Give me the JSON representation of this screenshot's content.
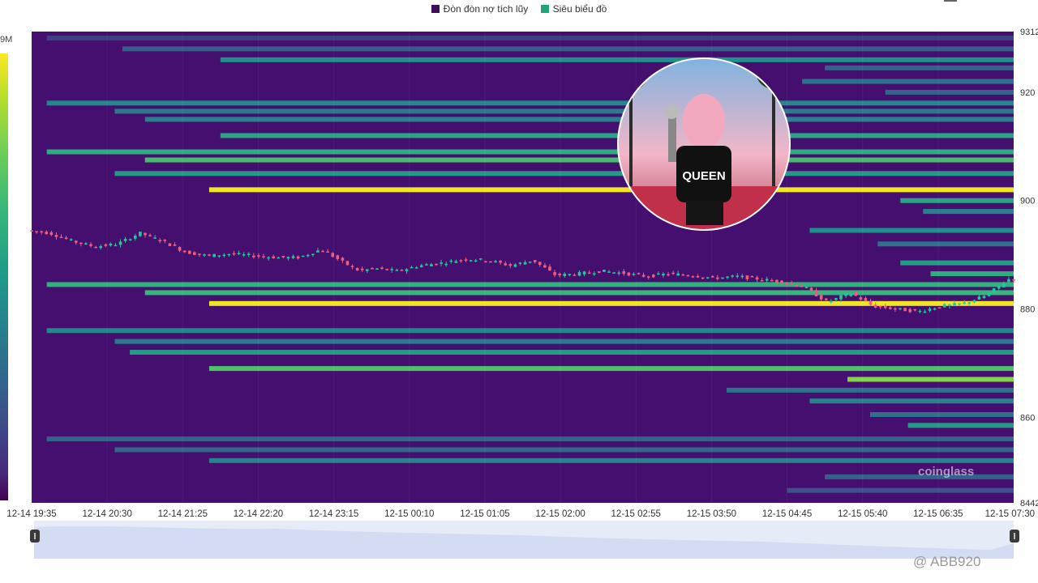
{
  "legend": {
    "items": [
      {
        "label": "Đòn đòn nợ tích lũy",
        "color": "#3b0f5c"
      },
      {
        "label": "Siêu biểu đồ",
        "color": "#1fa67a"
      }
    ]
  },
  "colorbar": {
    "label": "9M"
  },
  "watermark": "coinglass",
  "credit": "@ ABB920",
  "chart_data": {
    "type": "heatmap",
    "title": "",
    "ylim": [
      84420,
      93120
    ],
    "y_ticks": [
      "9312",
      "920",
      "900",
      "880",
      "860",
      "8442"
    ],
    "y_tick_values": [
      93120,
      92000,
      90000,
      88000,
      86000,
      84420
    ],
    "x_ticks": [
      "12-14 19:35",
      "12-14 20:30",
      "12-14 21:25",
      "12-14 22:20",
      "12-14 23:15",
      "12-15 00:10",
      "12-15 01:05",
      "12-15 02:00",
      "12-15 02:55",
      "12-15 03:50",
      "12-15 04:45",
      "12-15 05:40",
      "12-15 06:35",
      "12-15 07:30"
    ],
    "xlim": [
      0,
      13
    ],
    "background_color": "#440f6e",
    "bands": [
      {
        "price": 93000,
        "start": 0.2,
        "intensity": 0.18
      },
      {
        "price": 92800,
        "start": 1.2,
        "intensity": 0.28
      },
      {
        "price": 92600,
        "start": 2.5,
        "intensity": 0.45
      },
      {
        "price": 92450,
        "start": 10.5,
        "intensity": 0.3
      },
      {
        "price": 92200,
        "start": 10.2,
        "intensity": 0.35
      },
      {
        "price": 92000,
        "start": 11.3,
        "intensity": 0.3
      },
      {
        "price": 91800,
        "start": 0.2,
        "intensity": 0.42
      },
      {
        "price": 91650,
        "start": 1.1,
        "intensity": 0.38
      },
      {
        "price": 91500,
        "start": 1.5,
        "intensity": 0.4
      },
      {
        "price": 91200,
        "start": 2.5,
        "intensity": 0.55
      },
      {
        "price": 90900,
        "start": 0.2,
        "intensity": 0.6
      },
      {
        "price": 90750,
        "start": 1.5,
        "intensity": 0.68
      },
      {
        "price": 90500,
        "start": 1.1,
        "intensity": 0.5
      },
      {
        "price": 90200,
        "start": 2.35,
        "intensity": 0.98
      },
      {
        "price": 90000,
        "start": 11.5,
        "intensity": 0.55
      },
      {
        "price": 89800,
        "start": 11.8,
        "intensity": 0.4
      },
      {
        "price": 89450,
        "start": 10.3,
        "intensity": 0.45
      },
      {
        "price": 89200,
        "start": 11.2,
        "intensity": 0.35
      },
      {
        "price": 88850,
        "start": 11.5,
        "intensity": 0.5
      },
      {
        "price": 88650,
        "start": 11.9,
        "intensity": 0.6
      },
      {
        "price": 88450,
        "start": 0.2,
        "intensity": 0.62
      },
      {
        "price": 88300,
        "start": 1.5,
        "intensity": 0.65
      },
      {
        "price": 88100,
        "start": 2.35,
        "intensity": 0.98
      },
      {
        "price": 87600,
        "start": 0.2,
        "intensity": 0.42
      },
      {
        "price": 87400,
        "start": 1.1,
        "intensity": 0.38
      },
      {
        "price": 87200,
        "start": 1.3,
        "intensity": 0.5
      },
      {
        "price": 86900,
        "start": 2.35,
        "intensity": 0.7
      },
      {
        "price": 86700,
        "start": 10.8,
        "intensity": 0.8
      },
      {
        "price": 86500,
        "start": 9.2,
        "intensity": 0.35
      },
      {
        "price": 86300,
        "start": 10.3,
        "intensity": 0.4
      },
      {
        "price": 86050,
        "start": 11.1,
        "intensity": 0.35
      },
      {
        "price": 85850,
        "start": 11.6,
        "intensity": 0.5
      },
      {
        "price": 85600,
        "start": 0.2,
        "intensity": 0.3
      },
      {
        "price": 85400,
        "start": 1.1,
        "intensity": 0.32
      },
      {
        "price": 85200,
        "start": 2.35,
        "intensity": 0.4
      },
      {
        "price": 84900,
        "start": 10.5,
        "intensity": 0.3
      },
      {
        "price": 84650,
        "start": 10.0,
        "intensity": 0.25
      }
    ],
    "price_line": {
      "x": [
        0,
        0.3,
        0.6,
        0.9,
        1.2,
        1.5,
        1.8,
        2.1,
        2.4,
        2.7,
        3.0,
        3.3,
        3.6,
        3.9,
        4.2,
        4.4,
        4.6,
        4.9,
        5.2,
        5.5,
        5.8,
        6.1,
        6.4,
        6.7,
        7.0,
        7.3,
        7.6,
        7.9,
        8.2,
        8.5,
        8.8,
        9.1,
        9.4,
        9.7,
        10.0,
        10.3,
        10.6,
        10.9,
        11.2,
        11.5,
        11.8,
        12.1,
        12.4,
        12.7,
        13.0
      ],
      "y": [
        89450,
        89400,
        89250,
        89150,
        89200,
        89400,
        89250,
        89050,
        88980,
        89020,
        88980,
        88950,
        88950,
        89100,
        88850,
        88700,
        88750,
        88700,
        88800,
        88850,
        88920,
        88900,
        88800,
        88900,
        88620,
        88650,
        88700,
        88660,
        88600,
        88650,
        88620,
        88570,
        88600,
        88550,
        88500,
        88400,
        88120,
        88300,
        88050,
        88000,
        87950,
        88050,
        88100,
        88250,
        88550
      ]
    }
  }
}
